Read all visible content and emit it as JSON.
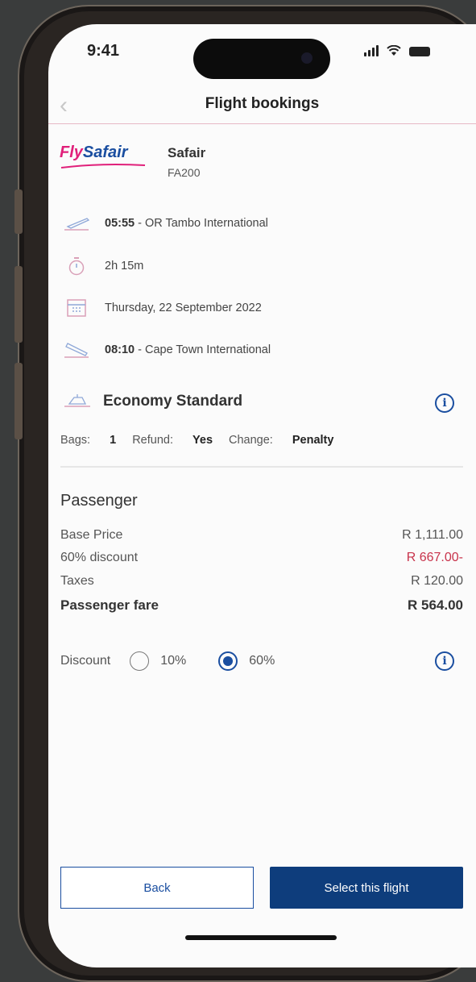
{
  "status_bar": {
    "time": "9:41"
  },
  "header": {
    "title": "Flight bookings"
  },
  "airline": {
    "logo_part1": "Fly",
    "logo_part2": "Safair",
    "name": "Safair",
    "flight_number": "FA200"
  },
  "itinerary": {
    "departure_time": "05:55",
    "departure_airport": " - OR Tambo International",
    "duration": "2h 15m",
    "date": "Thursday, 22 September 2022",
    "arrival_time": "08:10",
    "arrival_airport": " - Cape Town International"
  },
  "fare": {
    "class": "Economy Standard",
    "bags_label": "Bags: ",
    "bags_value": "1",
    "refund_label": "Refund: ",
    "refund_value": "Yes",
    "change_label": "Change: ",
    "change_value": "Penalty"
  },
  "passenger": {
    "title": "Passenger",
    "rows": [
      {
        "label": "Base Price",
        "value": "R 1,111.00"
      },
      {
        "label": "60% discount",
        "value": "R 667.00-"
      },
      {
        "label": "Taxes",
        "value": "R 120.00"
      },
      {
        "label": "Passenger fare",
        "value": "R 564.00"
      }
    ]
  },
  "discount": {
    "label": "Discount",
    "options": [
      {
        "label": "10%",
        "selected": false
      },
      {
        "label": "60%",
        "selected": true
      }
    ]
  },
  "actions": {
    "back": "Back",
    "select": "Select this flight"
  },
  "colors": {
    "brand_blue": "#1a4ea0",
    "button_blue": "#0e3d7c",
    "discount_red": "#c8334b",
    "accent_pink": "#e0207a"
  },
  "icons": {
    "back": "chevron-left-icon",
    "info": "info-icon",
    "takeoff": "takeoff-icon",
    "timer": "timer-icon",
    "calendar": "calendar-icon",
    "landing": "landing-icon",
    "cabin": "seat-icon"
  }
}
